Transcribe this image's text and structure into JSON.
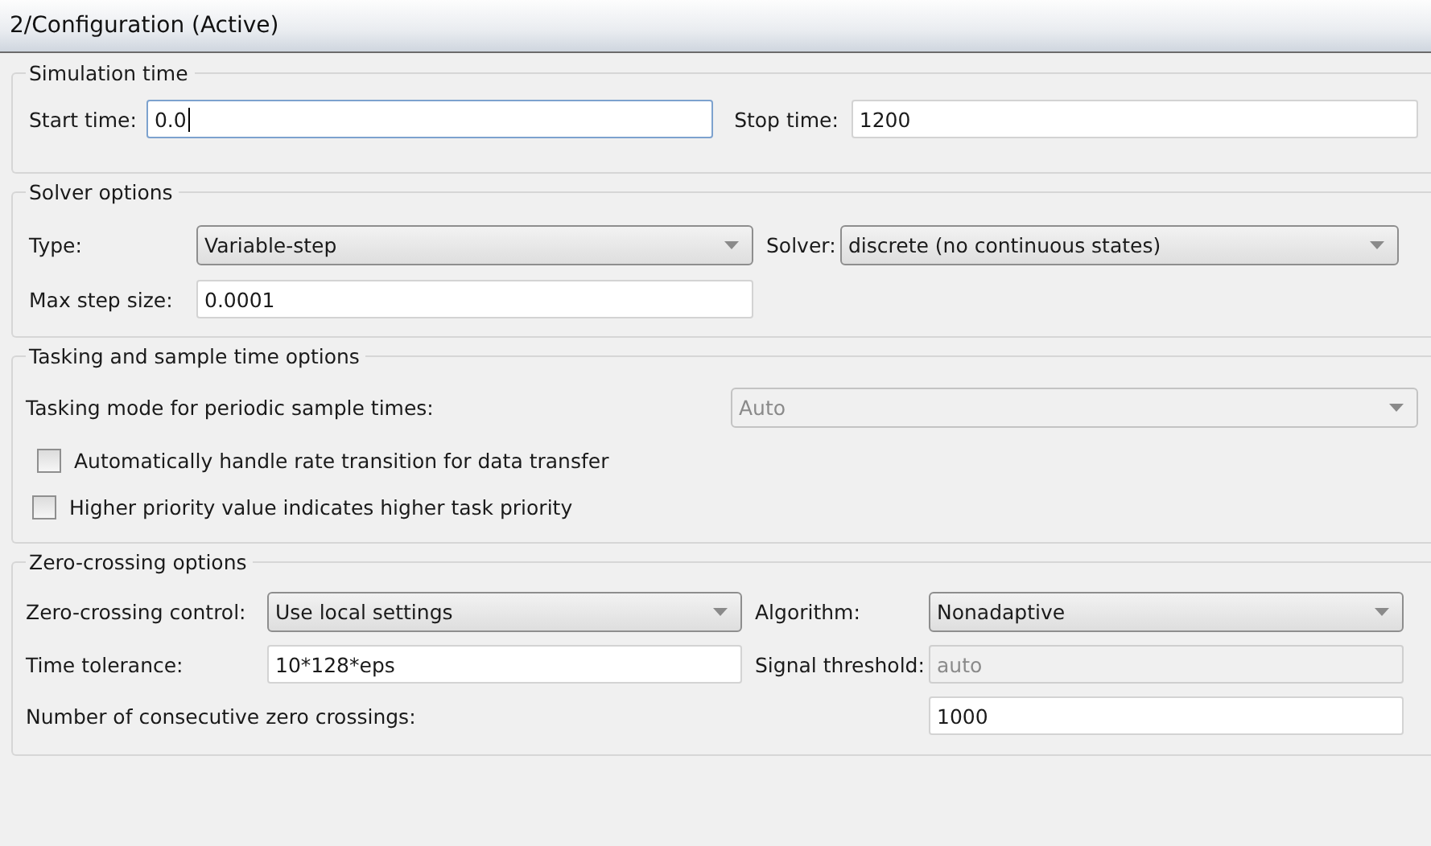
{
  "window": {
    "title": "2/Configuration (Active)"
  },
  "simulation_time": {
    "title": "Simulation time",
    "start_time": {
      "label": "Start time:",
      "value": "0.0",
      "focused": true
    },
    "stop_time": {
      "label": "Stop time:",
      "value": "1200",
      "focused": false
    }
  },
  "solver_options": {
    "title": "Solver options",
    "type": {
      "label": "Type:",
      "value": "Variable-step"
    },
    "solver": {
      "label": "Solver:",
      "value": "discrete (no continuous states)"
    },
    "max_step_size": {
      "label": "Max step size:",
      "value": "0.0001"
    }
  },
  "tasking": {
    "title": "Tasking and sample time options",
    "tasking_mode": {
      "label": "Tasking mode for periodic sample times:",
      "value": "Auto",
      "disabled": true
    },
    "checkboxes": [
      {
        "label": "Automatically handle rate transition for data transfer",
        "checked": false
      },
      {
        "label": "Higher priority value indicates higher task priority",
        "checked": false
      }
    ]
  },
  "zero_crossing": {
    "title": "Zero-crossing options",
    "control": {
      "label": "Zero-crossing control:",
      "value": "Use local settings"
    },
    "algorithm": {
      "label": "Algorithm:",
      "value": "Nonadaptive"
    },
    "time_tolerance": {
      "label": "Time tolerance:",
      "value": "10*128*eps"
    },
    "signal_threshold": {
      "label": "Signal threshold:",
      "value": "auto",
      "disabled": true
    },
    "consecutive": {
      "label": "Number of consecutive zero crossings:",
      "value": "1000"
    }
  }
}
